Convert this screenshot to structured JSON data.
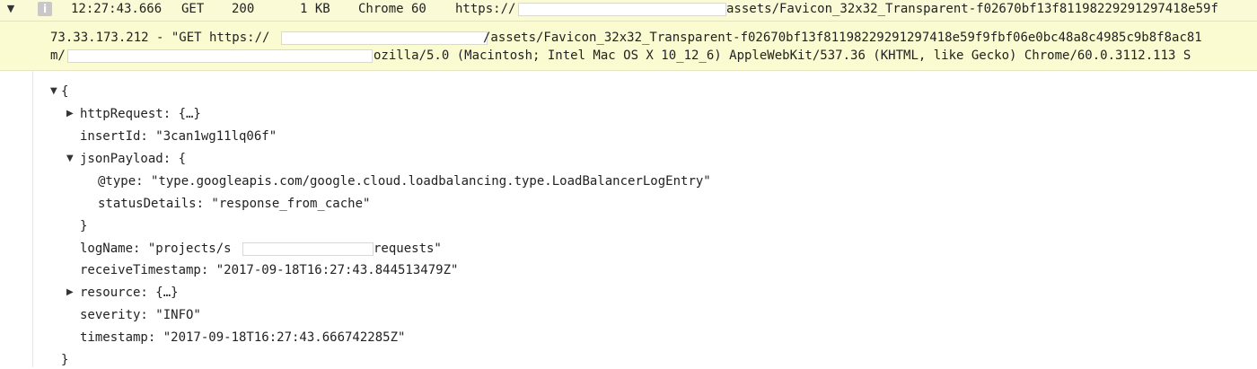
{
  "header": {
    "time": "12:27:43.666",
    "method": "GET",
    "status": "200",
    "size": "1 KB",
    "agent": "Chrome 60",
    "url_prefix": "https://",
    "url_suffix": "assets/Favicon_32x32_Transparent-f02670bf13f81198229291297418e59f"
  },
  "detail": {
    "line1_prefix": "73.33.173.212 - \"GET https://",
    "line1_suffix": "/assets/Favicon_32x32_Transparent-f02670bf13f81198229291297418e59f9fbf06e0bc48a8c4985c9b8f8ac81",
    "line2_prefix": "m/",
    "line2_suffix": "ozilla/5.0 (Macintosh; Intel Mac OS X 10_12_6) AppleWebKit/537.36 (KHTML, like Gecko) Chrome/60.0.3112.113 S"
  },
  "json": {
    "open_brace": "{",
    "close_brace": "}",
    "http_request": "httpRequest: {…}",
    "insert_id": "insertId: \"3can1wg11lq06f\"",
    "json_payload_open": "jsonPayload: {",
    "type": "@type: \"type.googleapis.com/google.cloud.loadbalancing.type.LoadBalancerLogEntry\"",
    "status_details": "statusDetails: \"response_from_cache\"",
    "json_payload_close": "}",
    "log_name_prefix": "logName: \"projects/s",
    "log_name_suffix": "requests\"",
    "receive_timestamp": "receiveTimestamp: \"2017-09-18T16:27:43.844513479Z\"",
    "resource": "resource: {…}",
    "severity": "severity: \"INFO\"",
    "timestamp": "timestamp: \"2017-09-18T16:27:43.666742285Z\""
  },
  "icons": {
    "expand": "▼",
    "collapsed": "▶",
    "info_badge": "i"
  }
}
